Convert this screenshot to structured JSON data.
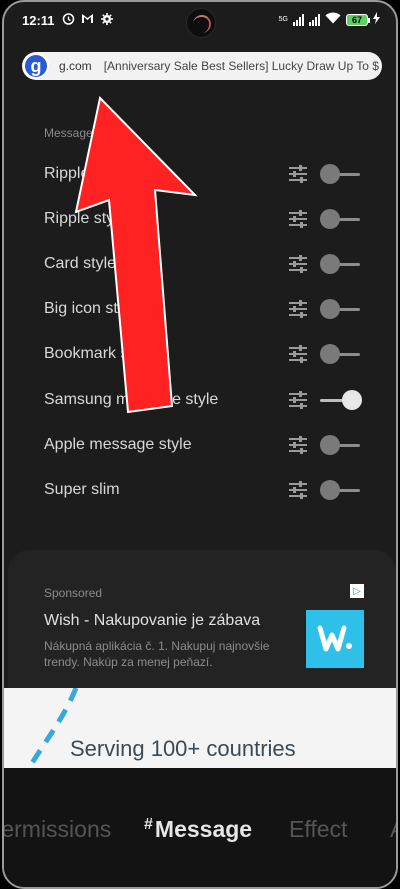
{
  "status": {
    "time": "12:11",
    "battery": "67",
    "network": "5G"
  },
  "urlbar": {
    "logo_letter": "g",
    "domain": "g.com",
    "text": "[Anniversary Sale Best Sellers] Lucky Draw Up To $"
  },
  "settings": {
    "section_label": "Message",
    "items": [
      {
        "label": "Ripple style",
        "on": false
      },
      {
        "label": "Ripple style",
        "on": false
      },
      {
        "label": "Card style",
        "on": false
      },
      {
        "label": "Big icon style",
        "on": false
      },
      {
        "label": "Bookmark style",
        "on": false
      },
      {
        "label": "Samsung message style",
        "on": true
      },
      {
        "label": "Apple message style",
        "on": false
      },
      {
        "label": "Super slim",
        "on": false
      }
    ]
  },
  "ad": {
    "sponsored": "Sponsored",
    "title": "Wish - Nakupovanie je zábava",
    "description": "Nákupná aplikácia č. 1. Nakupuj najnovšie trendy. Nakúp za menej peňazí.",
    "brand_color": "#2ec0e8"
  },
  "promo": {
    "text": "Serving 100+ countries"
  },
  "tabs": {
    "items": [
      {
        "label": "Permissions"
      },
      {
        "hash": "#",
        "label": "Message"
      },
      {
        "label": "Effect"
      },
      {
        "label": "A"
      }
    ]
  },
  "annotation_color": "#ff2222"
}
